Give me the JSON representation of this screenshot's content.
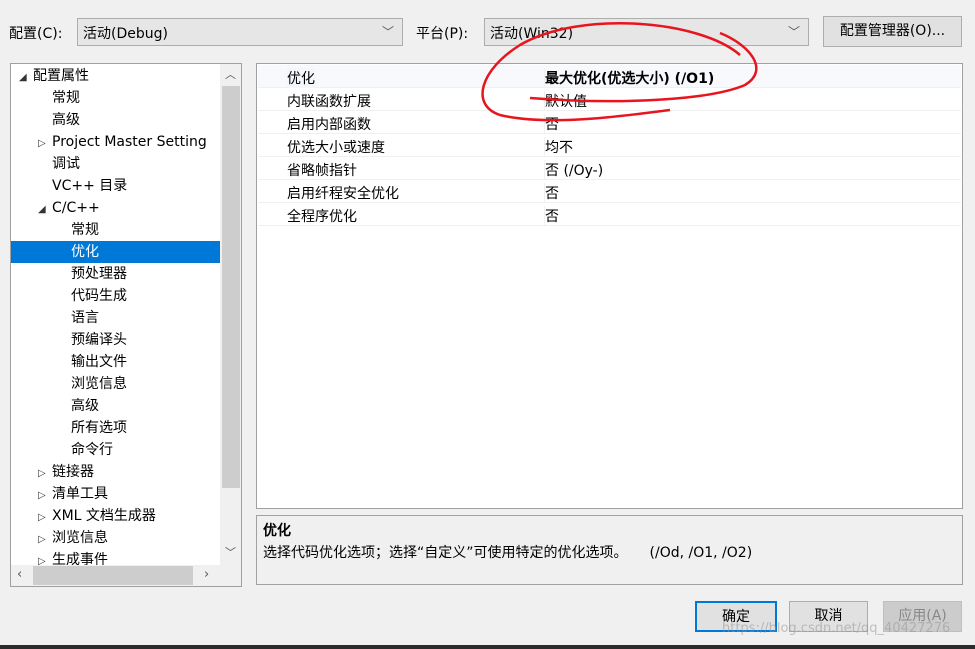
{
  "toolbar": {
    "config_label": "配置(C):",
    "config_value": "活动(Debug)",
    "platform_label": "平台(P):",
    "platform_value": "活动(Win32)",
    "config_manager": "配置管理器(O)..."
  },
  "tree": [
    {
      "label": "配置属性",
      "level": 0,
      "toggle": "expanded"
    },
    {
      "label": "常规",
      "level": 1
    },
    {
      "label": "高级",
      "level": 1
    },
    {
      "label": "Project Master Setting",
      "level": 1,
      "toggle": "collapsed"
    },
    {
      "label": "调试",
      "level": 1
    },
    {
      "label": "VC++ 目录",
      "level": 1
    },
    {
      "label": "C/C++",
      "level": 1,
      "toggle": "expanded"
    },
    {
      "label": "常规",
      "level": 2
    },
    {
      "label": "优化",
      "level": 2,
      "selected": true
    },
    {
      "label": "预处理器",
      "level": 2
    },
    {
      "label": "代码生成",
      "level": 2
    },
    {
      "label": "语言",
      "level": 2
    },
    {
      "label": "预编译头",
      "level": 2
    },
    {
      "label": "输出文件",
      "level": 2
    },
    {
      "label": "浏览信息",
      "level": 2
    },
    {
      "label": "高级",
      "level": 2
    },
    {
      "label": "所有选项",
      "level": 2
    },
    {
      "label": "命令行",
      "level": 2
    },
    {
      "label": "链接器",
      "level": 1,
      "toggle": "collapsed"
    },
    {
      "label": "清单工具",
      "level": 1,
      "toggle": "collapsed"
    },
    {
      "label": "XML 文档生成器",
      "level": 1,
      "toggle": "collapsed"
    },
    {
      "label": "浏览信息",
      "level": 1,
      "toggle": "collapsed"
    },
    {
      "label": "生成事件",
      "level": 1,
      "toggle": "collapsed"
    }
  ],
  "properties": [
    {
      "name": "优化",
      "value": "最大优化(优选大小) (/O1)",
      "bold": true
    },
    {
      "name": "内联函数扩展",
      "value": "默认值"
    },
    {
      "name": "启用内部函数",
      "value": "否"
    },
    {
      "name": "优选大小或速度",
      "value": "均不"
    },
    {
      "name": "省略帧指针",
      "value": "否 (/Oy-)"
    },
    {
      "name": "启用纤程安全优化",
      "value": "否"
    },
    {
      "name": "全程序优化",
      "value": "否"
    }
  ],
  "description": {
    "title": "优化",
    "text": "选择代码优化选项；选择“自定义”可使用特定的优化选项。",
    "flags": "(/Od, /O1, /O2)"
  },
  "buttons": {
    "ok": "确定",
    "cancel": "取消",
    "apply": "应用(A)"
  },
  "watermark": "https://blog.csdn.net/qq_40427276",
  "colors": {
    "selection": "#0078d7",
    "annotation": "#e8141e"
  }
}
